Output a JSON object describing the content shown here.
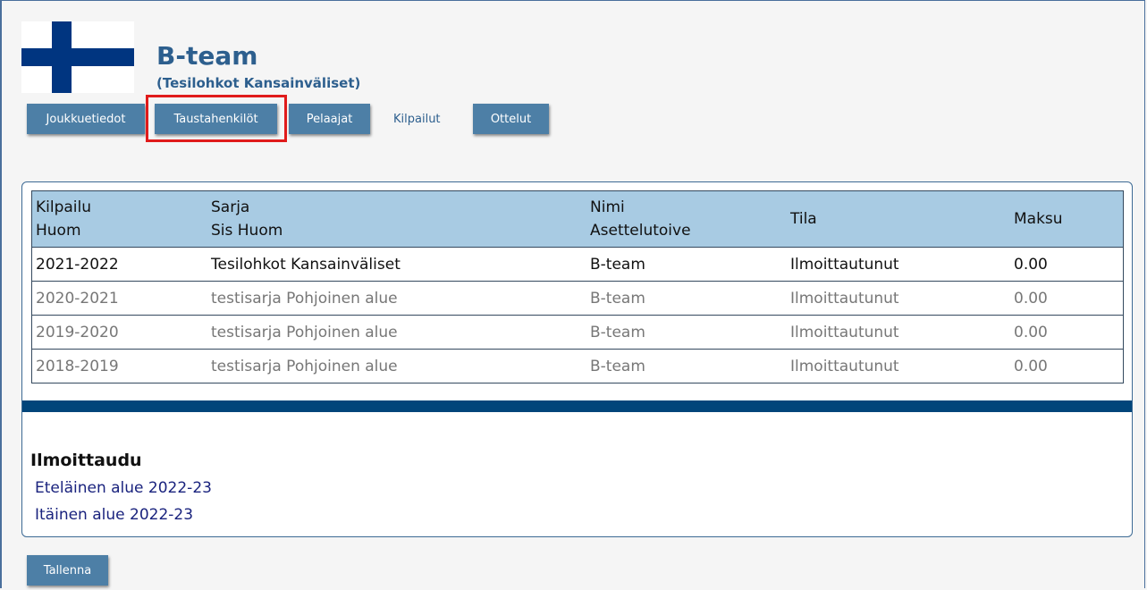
{
  "team": {
    "name": "B-team",
    "series": "(Tesilohkot Kansainväliset)"
  },
  "nav": {
    "joukkuetiedot": "Joukkuetiedot",
    "taustahenkilot": "Taustahenkilöt",
    "pelaajat": "Pelaajat",
    "kilpailut": "Kilpailut",
    "ottelut": "Ottelut"
  },
  "table": {
    "headers": {
      "kilpailu": "Kilpailu",
      "huom": "Huom",
      "sarja": "Sarja",
      "sis_huom": "Sis Huom",
      "nimi": "Nimi",
      "asettelutoive": "Asettelutoive",
      "tila": "Tila",
      "maksu": "Maksu"
    },
    "rows": [
      {
        "kilpailu": "2021-2022",
        "sarja": "Tesilohkot Kansainväliset",
        "nimi": "B-team",
        "tila": "Ilmoittautunut",
        "maksu": "0.00"
      },
      {
        "kilpailu": "2020-2021",
        "sarja": "testisarja Pohjoinen alue",
        "nimi": "B-team",
        "tila": "Ilmoittautunut",
        "maksu": "0.00"
      },
      {
        "kilpailu": "2019-2020",
        "sarja": "testisarja Pohjoinen alue",
        "nimi": "B-team",
        "tila": "Ilmoittautunut",
        "maksu": "0.00"
      },
      {
        "kilpailu": "2018-2019",
        "sarja": "testisarja Pohjoinen alue",
        "nimi": "B-team",
        "tila": "Ilmoittautunut",
        "maksu": "0.00"
      }
    ]
  },
  "signup": {
    "title": "Ilmoittaudu",
    "links": [
      "Eteläinen alue 2022-23",
      "Itäinen alue 2022-23"
    ]
  },
  "save_label": "Tallenna",
  "colors": {
    "header_bg": "#a8cbe3",
    "button_bg": "#4d7fa6",
    "divider": "#01457a",
    "highlight": "#e01b1b"
  }
}
